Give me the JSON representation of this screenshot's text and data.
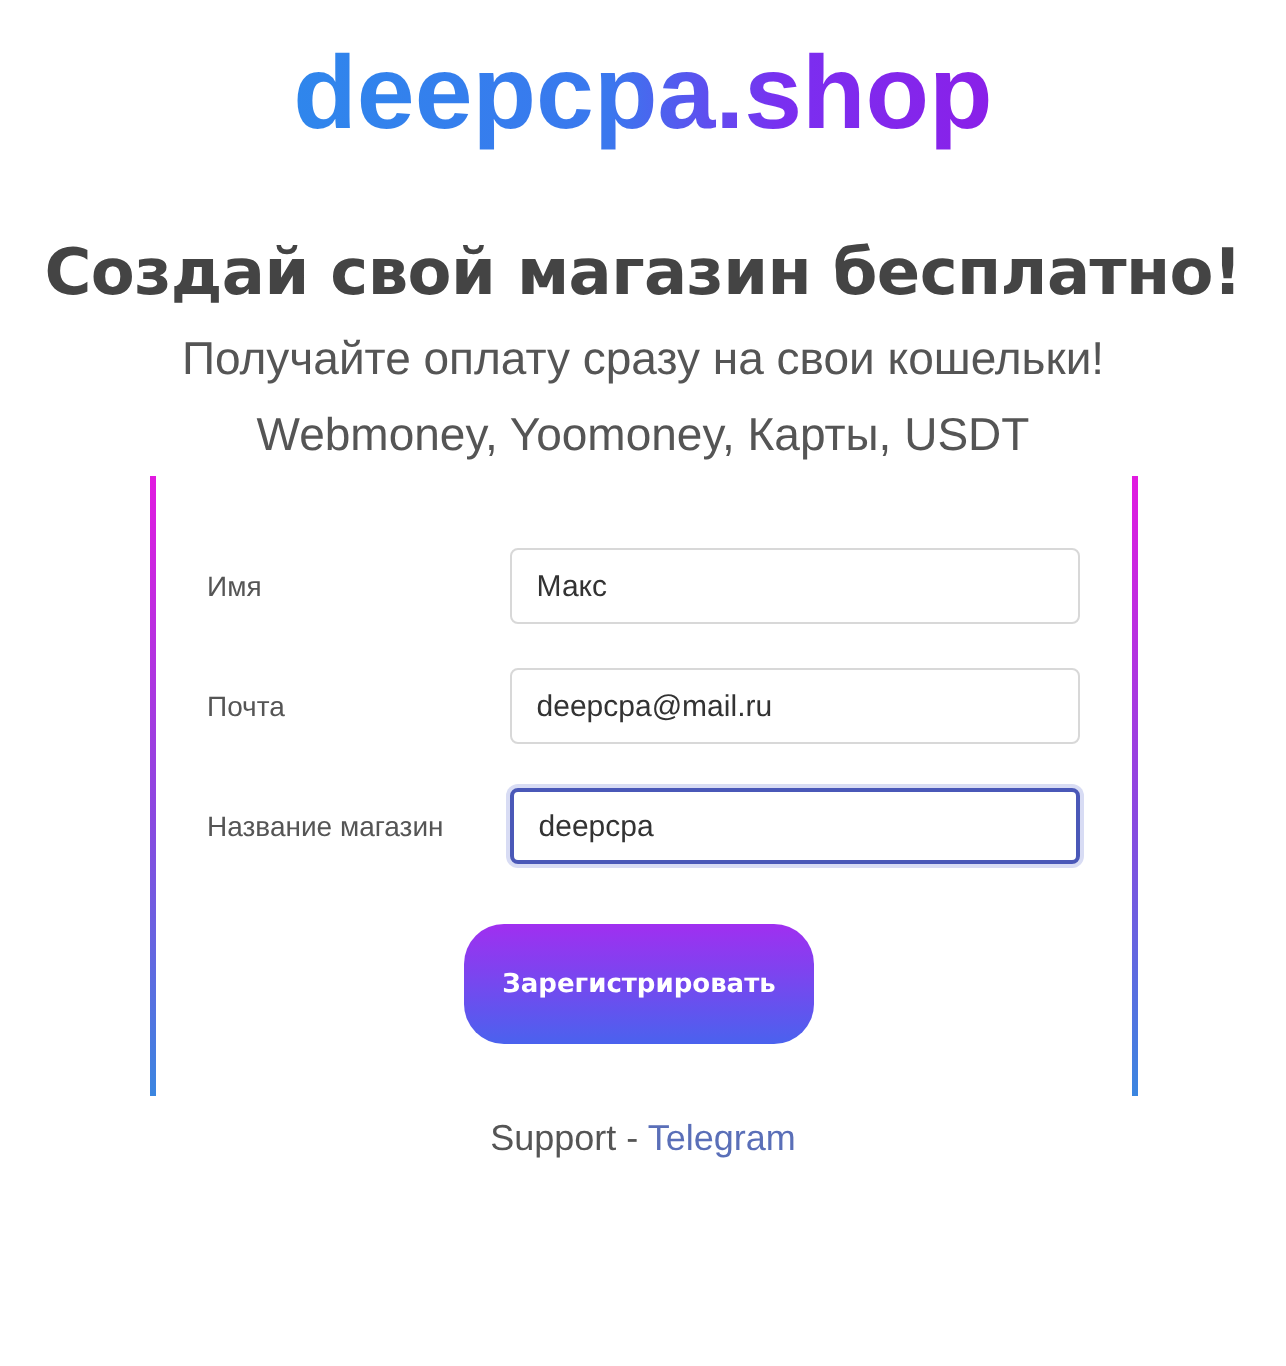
{
  "logo": "deepcpa.shop",
  "heading": "Создай свой магазин бесплатно!",
  "subtitles": [
    "Получайте оплату сразу на свои кошельки!",
    "Webmoney, Yoomoney, Карты, USDT"
  ],
  "fields": [
    {
      "label": "Имя",
      "value": "Макс",
      "focused": false
    },
    {
      "label": "Почта",
      "value": "deepcpa@mail.ru",
      "focused": false
    },
    {
      "label": "Название магазин",
      "value": "deepcpa",
      "focused": true
    }
  ],
  "submit_button": "Зарегистрировать",
  "support": {
    "text": "Support - ",
    "link": "Telegram"
  }
}
